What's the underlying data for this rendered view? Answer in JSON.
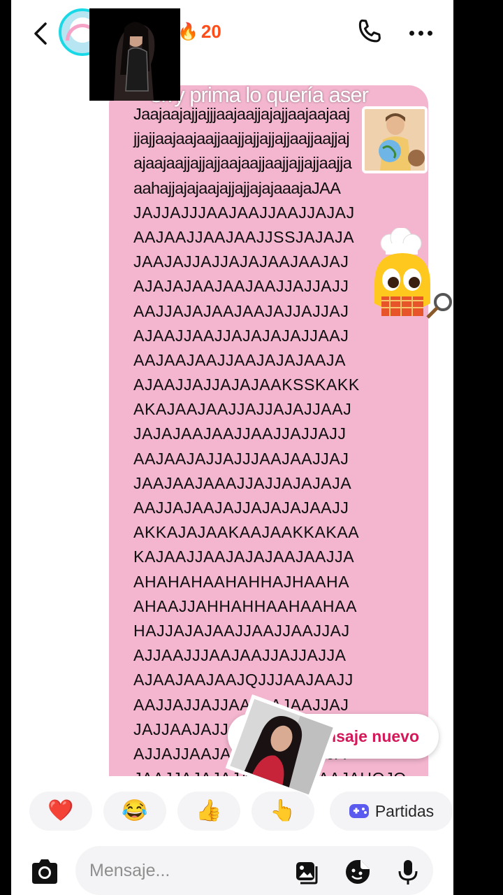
{
  "header": {
    "streak_count": "20",
    "streak_icon": "fire-icon",
    "call_icon": "phone-icon",
    "more_icon": "more-dots-icon",
    "back_icon": "chevron-left-icon"
  },
  "message": {
    "overlay_caption": "srry prima lo quería aser",
    "lines": [
      {
        "text": "Jaajaajajjajjjaajaajjajajjaajaajaaj",
        "lower": true
      },
      {
        "text": "jjajjaajaajaajjaajjajjajjajjaajjaajjaj",
        "lower": true
      },
      {
        "text": "ajaajaajjajjajjaajaajjaajjajjajjaajja",
        "lower": true
      },
      {
        "text": "aahajjajajaajajjajjajajaaajaJAA",
        "lower": true
      },
      {
        "text": "JAJJAJJJAAJAAJJAAJJAJAJ",
        "lower": false
      },
      {
        "text": "AAJAAJJAAJAAJJSSJAJAJA",
        "lower": false
      },
      {
        "text": "JAAJAJJAJJAJAJAAJAAJAJ",
        "lower": false
      },
      {
        "text": "AJAJAJAAJAAJAAJJAJJAJJ",
        "lower": false
      },
      {
        "text": "AAJJAJAJAAJAAJAJJAJJAJ",
        "lower": false
      },
      {
        "text": "AJAAJJAAJJAJAJAJAJJAAJ",
        "lower": false
      },
      {
        "text": "AAJAAJAAJJAAJAJAJAAJA",
        "lower": false
      },
      {
        "text": "AJAAJJAJJAJAJAAKSSKAKK",
        "lower": false
      },
      {
        "text": "AKAJAAJAAJJAJJAJAJJAAJ",
        "lower": false
      },
      {
        "text": "JAJAJAAJAAJJAAJJAJJAJJ",
        "lower": false
      },
      {
        "text": "AAJAAJAJJAJJJAAJAAJJAJ",
        "lower": false
      },
      {
        "text": "JAAJAAJAAAJJAJJAJAJAJA",
        "lower": false
      },
      {
        "text": "AAJJAJAAJAJJAJAJAJAAJJ",
        "lower": false
      },
      {
        "text": "AKKAJAJAAKAAJAAKKAKAA",
        "lower": false
      },
      {
        "text": "KAJAAJJAAJAJAJAAJAAJJA",
        "lower": false
      },
      {
        "text": "AHAHAHAAHAHHAJHAAHA",
        "lower": false
      },
      {
        "text": "AHAAJJAHHAHHAAHAAHAA",
        "lower": false
      },
      {
        "text": "HAJJAJAJAAJJAAJJAAJJAJ",
        "lower": false
      },
      {
        "text": "AJJAAJJJAAJAAJJAJJAJJA",
        "lower": false
      },
      {
        "text": "AJAAJAAJAAJQJJJAAJAAJJ",
        "lower": false
      },
      {
        "text": "AAJJAJJAJJAAJAAJAAJJAJ",
        "lower": false
      },
      {
        "text": "JAJJAAJAJJAJJAJAJAAJJA",
        "lower": false
      },
      {
        "text": "AJJAJJAAJAJAJJAJAJAJJA",
        "lower": false
      },
      {
        "text": "JAAJJAJAJAJAJAJJAAJAAJAHOJO",
        "lower": false
      }
    ]
  },
  "new_message_pill": {
    "label": "nsaje nuevo"
  },
  "quick_replies": [
    {
      "emoji": "❤️",
      "name": "heart"
    },
    {
      "emoji": "😂",
      "name": "tears-of-joy"
    },
    {
      "emoji": "👍",
      "name": "thumbs-up"
    },
    {
      "emoji": "👆",
      "name": "pointing"
    }
  ],
  "games_chip": {
    "label": "Partidas",
    "icon": "gamepad-icon",
    "icon_color": "#5b5bf0"
  },
  "composer": {
    "placeholder": "Mensaje...",
    "icons": [
      "camera-icon",
      "gallery-icon",
      "sticker-icon",
      "microphone-icon"
    ]
  },
  "colors": {
    "message_bg": "#f4b6cf",
    "accent_red": "#d4195a",
    "streak_orange": "#ff4d1a"
  }
}
